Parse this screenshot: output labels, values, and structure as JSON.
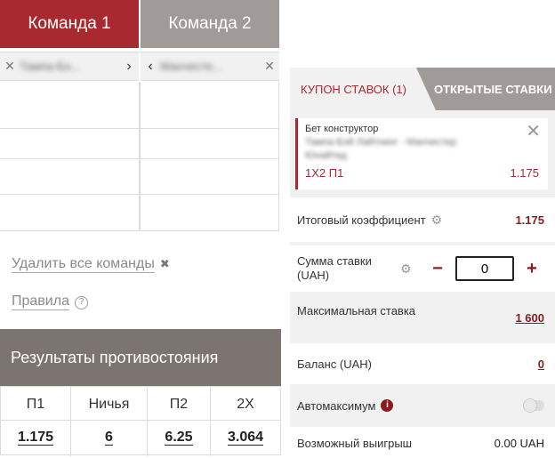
{
  "teams": {
    "team1_label": "Команда 1",
    "team2_label": "Команда 2",
    "team1_selected": "Тампа-Бэ...",
    "team2_selected": "Манчесте..."
  },
  "links": {
    "delete_all": "Удалить все команды",
    "rules": "Правила"
  },
  "results": {
    "title": "Результаты противостояния",
    "columns": [
      {
        "label": "П1",
        "value": "1.175"
      },
      {
        "label": "Ничья",
        "value": "6"
      },
      {
        "label": "П2",
        "value": "6.25"
      },
      {
        "label": "2Х",
        "value": "3.064"
      }
    ]
  },
  "coupon": {
    "tab_coupon": "КУПОН СТАВОК (1)",
    "tab_open": "ОТКРЫТЫЕ СТАВКИ",
    "bet": {
      "type": "Бет конструктор",
      "match": "Тампа-Бэй Лайтнинг - Манчестер Юнайтед",
      "outcome": "1X2 П1",
      "odds": "1.175"
    },
    "total_coef_label": "Итоговый коэффициент",
    "total_coef_value": "1.175",
    "stake_label": "Сумма ставки (UAH)",
    "stake_value": "0",
    "max_stake_label": "Максимальная ставка",
    "max_stake_value": "1 600",
    "balance_label": "Баланс (UAH)",
    "balance_value": "0",
    "automax_label": "Автомаксимум",
    "possible_win_label": "Возможный выигрыш",
    "possible_win_value": "0.00 UAH"
  },
  "colors": {
    "brand_red": "#a8292f",
    "tab_grey": "#a09a99",
    "results_header": "#7c7471"
  }
}
